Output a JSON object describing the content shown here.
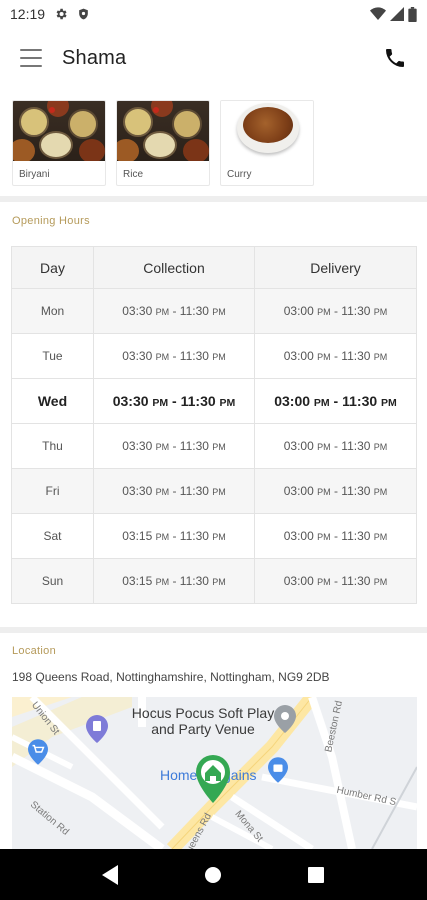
{
  "status_bar": {
    "time": "12:19"
  },
  "app_bar": {
    "title": "Shama"
  },
  "categories": [
    {
      "label": "Biryani"
    },
    {
      "label": "Rice"
    },
    {
      "label": "Curry"
    }
  ],
  "opening_hours": {
    "section_title": "Opening Hours",
    "headers": {
      "day": "Day",
      "collection": "Collection",
      "delivery": "Delivery"
    },
    "rows": [
      {
        "day": "Mon",
        "c_from": "03:30",
        "c_from_ampm": "PM",
        "c_to": "11:30",
        "c_to_ampm": "PM",
        "d_from": "03:00",
        "d_from_ampm": "PM",
        "d_to": "11:30",
        "d_to_ampm": "PM"
      },
      {
        "day": "Tue",
        "c_from": "03:30",
        "c_from_ampm": "PM",
        "c_to": "11:30",
        "c_to_ampm": "PM",
        "d_from": "03:00",
        "d_from_ampm": "PM",
        "d_to": "11:30",
        "d_to_ampm": "PM"
      },
      {
        "day": "Wed",
        "c_from": "03:30",
        "c_from_ampm": "PM",
        "c_to": "11:30",
        "c_to_ampm": "PM",
        "d_from": "03:00",
        "d_from_ampm": "PM",
        "d_to": "11:30",
        "d_to_ampm": "PM"
      },
      {
        "day": "Thu",
        "c_from": "03:30",
        "c_from_ampm": "PM",
        "c_to": "11:30",
        "c_to_ampm": "PM",
        "d_from": "03:00",
        "d_from_ampm": "PM",
        "d_to": "11:30",
        "d_to_ampm": "PM"
      },
      {
        "day": "Fri",
        "c_from": "03:30",
        "c_from_ampm": "PM",
        "c_to": "11:30",
        "c_to_ampm": "PM",
        "d_from": "03:00",
        "d_from_ampm": "PM",
        "d_to": "11:30",
        "d_to_ampm": "PM"
      },
      {
        "day": "Sat",
        "c_from": "03:15",
        "c_from_ampm": "PM",
        "c_to": "11:30",
        "c_to_ampm": "PM",
        "d_from": "03:00",
        "d_from_ampm": "PM",
        "d_to": "11:30",
        "d_to_ampm": "PM"
      },
      {
        "day": "Sun",
        "c_from": "03:15",
        "c_from_ampm": "PM",
        "c_to": "11:30",
        "c_to_ampm": "PM",
        "d_from": "03:00",
        "d_from_ampm": "PM",
        "d_to": "11:30",
        "d_to_ampm": "PM"
      }
    ],
    "highlighted_day": "Wed"
  },
  "location": {
    "section_title": "Location",
    "address": "198 Queens Road, Nottinghamshire, Nottingham, NG9 2DB",
    "map": {
      "poi_name": "Hocus Pocus Soft Play and Party Venue",
      "poi_shop": "Home Bargains",
      "roads": [
        "Union St",
        "Station Rd",
        "Beeston Rd",
        "Mona St",
        "Queens Rd",
        "Humber Rd S"
      ]
    }
  },
  "icons": {
    "menu": "hamburger-menu-icon",
    "phone": "phone-icon",
    "back": "back-triangle-icon",
    "home": "home-circle-icon",
    "recents": "recents-square-icon"
  },
  "colors": {
    "section_title": "#b59a5a",
    "map_pin_green": "#34a853",
    "map_pin_blue": "#4a8de8"
  }
}
